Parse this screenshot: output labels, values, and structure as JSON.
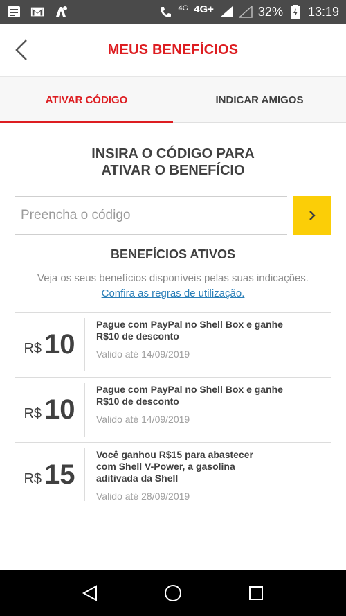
{
  "status_bar": {
    "net_small": "4G",
    "net_large": "4G+",
    "battery": "32%",
    "time": "13:19",
    "icons": [
      "message-icon",
      "gmail-icon",
      "avast-icon",
      "phone-wifi-icon",
      "signal-icon",
      "signal-empty-icon",
      "battery-charging-icon"
    ]
  },
  "header": {
    "title": "MEUS BENEFÍCIOS",
    "back_icon": "chevron-left-icon"
  },
  "tabs": [
    {
      "label": "ATIVAR CÓDIGO",
      "active": true
    },
    {
      "label": "INDICAR AMIGOS",
      "active": false
    }
  ],
  "code_section": {
    "title_line1": "INSIRA O CÓDIGO PARA",
    "title_line2": "ATIVAR O BENEFÍCIO",
    "input_placeholder": "Preencha o código",
    "input_value": "",
    "submit_icon": "chevron-right-icon"
  },
  "active_benefits": {
    "title": "BENEFÍCIOS ATIVOS",
    "subtitle": "Veja os seus benefícios disponíveis pelas suas indicações.",
    "rules_link": "Confira as regras de utilização.",
    "items": [
      {
        "currency": "R$",
        "value": "10",
        "desc_line1": "Pague com PayPal no Shell Box e ganhe",
        "desc_line2": "R$10 de desconto",
        "desc_line3": "",
        "valid": "Valido até 14/09/2019"
      },
      {
        "currency": "R$",
        "value": "10",
        "desc_line1": "Pague com PayPal no Shell Box e ganhe",
        "desc_line2": "R$10 de desconto",
        "desc_line3": "",
        "valid": "Valido até 14/09/2019"
      },
      {
        "currency": "R$",
        "value": "15",
        "desc_line1": "Você ganhou R$15 para abastecer",
        "desc_line2": "com Shell V-Power, a gasolina",
        "desc_line3": "aditivada da Shell",
        "valid": "Valido até 28/09/2019"
      }
    ]
  },
  "colors": {
    "brand_red": "#dd1d21",
    "brand_yellow": "#fbce07",
    "link_blue": "#2a7fb8",
    "text_dark": "#404040"
  },
  "nav_bar": {
    "icons": [
      "back-triangle-icon",
      "home-circle-icon",
      "recents-square-icon"
    ]
  }
}
